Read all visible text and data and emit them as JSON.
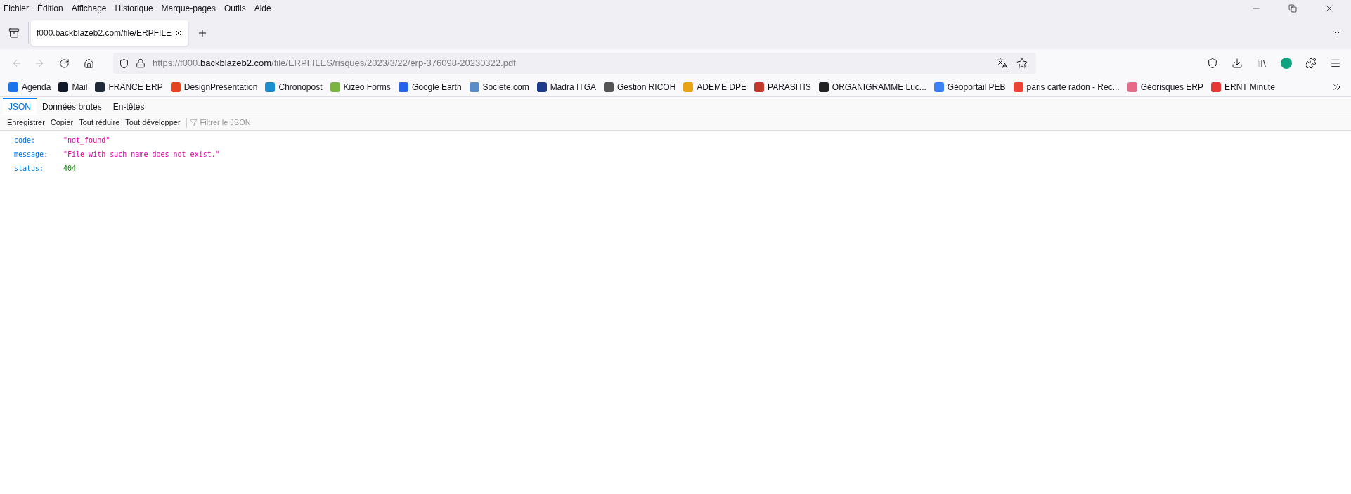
{
  "menu": [
    "Fichier",
    "Édition",
    "Affichage",
    "Historique",
    "Marque-pages",
    "Outils",
    "Aide"
  ],
  "tabs": [
    {
      "title": "f000.backblazeb2.com/file/ERPFILE",
      "selected": true
    }
  ],
  "url": {
    "prefix": "https://f000.",
    "domain": "backblazeb2.com",
    "path": "/file/ERPFILES/risques/2023/3/22/erp-376098-20230322.pdf"
  },
  "bookmarks": [
    {
      "label": "Agenda",
      "color": "#1a73e8"
    },
    {
      "label": "Mail",
      "color": "#111827"
    },
    {
      "label": "FRANCE ERP",
      "color": "#1f2937"
    },
    {
      "label": "DesignPresentation",
      "color": "#e2451e"
    },
    {
      "label": "Chronopost",
      "color": "#1d8fd1"
    },
    {
      "label": "Kizeo Forms",
      "color": "#7cb342"
    },
    {
      "label": "Google Earth",
      "color": "#2563eb"
    },
    {
      "label": "Societe.com",
      "color": "#5b8cc8"
    },
    {
      "label": "Madra ITGA",
      "color": "#1e3a8a"
    },
    {
      "label": "Gestion RICOH",
      "color": "#555555"
    },
    {
      "label": "ADEME DPE",
      "color": "#e8a317"
    },
    {
      "label": "PARASITIS",
      "color": "#c0392b"
    },
    {
      "label": "ORGANIGRAMME Luc...",
      "color": "#222222"
    },
    {
      "label": "Géoportail PEB",
      "color": "#3b82f6"
    },
    {
      "label": "paris carte radon - Rec...",
      "color": "#ea4335"
    },
    {
      "label": "Géorisques ERP",
      "color": "#e46b8a"
    },
    {
      "label": "ERNT Minute",
      "color": "#e53935"
    }
  ],
  "viewer_tabs": [
    {
      "label": "JSON",
      "selected": true
    },
    {
      "label": "Données brutes",
      "selected": false
    },
    {
      "label": "En-têtes",
      "selected": false
    }
  ],
  "toolbar": [
    "Enregistrer",
    "Copier",
    "Tout réduire",
    "Tout développer"
  ],
  "filter": {
    "placeholder": "Filtrer le JSON"
  },
  "rows": [
    {
      "key": "code:",
      "value": "\"not_found\"",
      "kind": "string"
    },
    {
      "key": "message:",
      "value": "\"File with such name does not exist.\"",
      "kind": "string"
    },
    {
      "key": "status:",
      "value": "404",
      "kind": "number"
    }
  ]
}
